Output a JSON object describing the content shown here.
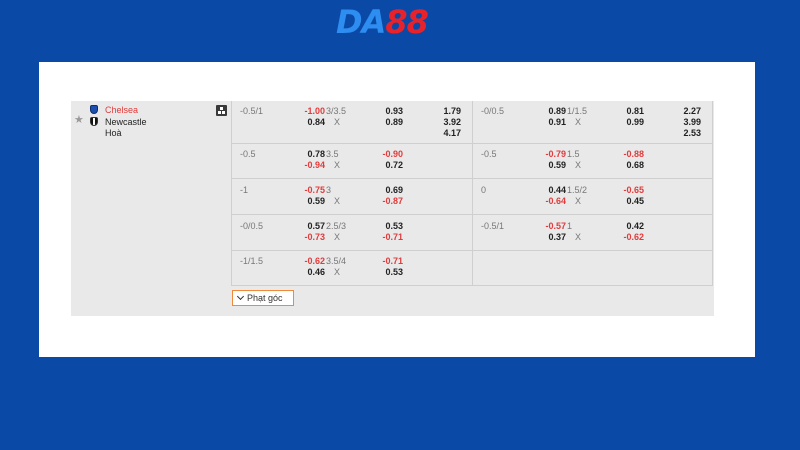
{
  "brand": {
    "logo_da": "DA",
    "logo_num": "88"
  },
  "match": {
    "home": "Chelsea",
    "away": "Newcastle",
    "draw": "Hoà"
  },
  "icons": {
    "star": "star-icon",
    "stats": "stats-icon",
    "chevron": "chevron-down-icon"
  },
  "colors": {
    "negative": "#e23b3b",
    "accent_border": "#f08a3a",
    "background": "#0a4aa6"
  },
  "rows": [
    {
      "left": {
        "hcap": "-0.5/1",
        "h1": "-1.00",
        "h2": "0.84",
        "ou": "3/3.5",
        "x": "X",
        "o1": "0.93",
        "o2": "0.89",
        "m1": "1.79",
        "m2": "3.92",
        "m3": "4.17"
      },
      "right": {
        "hcap": "-0/0.5",
        "h1": "0.89",
        "h2": "0.91",
        "ou": "1/1.5",
        "x": "X",
        "o1": "0.81",
        "o2": "0.99",
        "m1": "2.27",
        "m2": "3.99",
        "m3": "2.53"
      }
    },
    {
      "left": {
        "hcap": "-0.5",
        "h1": "0.78",
        "h2": "-0.94",
        "ou": "3.5",
        "x": "X",
        "o1": "-0.90",
        "o2": "0.72"
      },
      "right": {
        "hcap": "-0.5",
        "h1": "-0.79",
        "h2": "0.59",
        "ou": "1.5",
        "x": "X",
        "o1": "-0.88",
        "o2": "0.68"
      }
    },
    {
      "left": {
        "hcap": "-1",
        "h1": "-0.75",
        "h2": "0.59",
        "ou": "3",
        "x": "X",
        "o1": "0.69",
        "o2": "-0.87"
      },
      "right": {
        "hcap": "0",
        "h1": "0.44",
        "h2": "-0.64",
        "ou": "1.5/2",
        "x": "X",
        "o1": "-0.65",
        "o2": "0.45"
      }
    },
    {
      "left": {
        "hcap": "-0/0.5",
        "h1": "0.57",
        "h2": "-0.73",
        "ou": "2.5/3",
        "x": "X",
        "o1": "0.53",
        "o2": "-0.71"
      },
      "right": {
        "hcap": "-0.5/1",
        "h1": "-0.57",
        "h2": "0.37",
        "ou": "1",
        "x": "X",
        "o1": "0.42",
        "o2": "-0.62"
      }
    },
    {
      "left": {
        "hcap": "-1/1.5",
        "h1": "-0.62",
        "h2": "0.46",
        "ou": "3.5/4",
        "x": "X",
        "o1": "-0.71",
        "o2": "0.53"
      }
    }
  ],
  "footer": {
    "original_odds_label": "Phạt góc"
  }
}
